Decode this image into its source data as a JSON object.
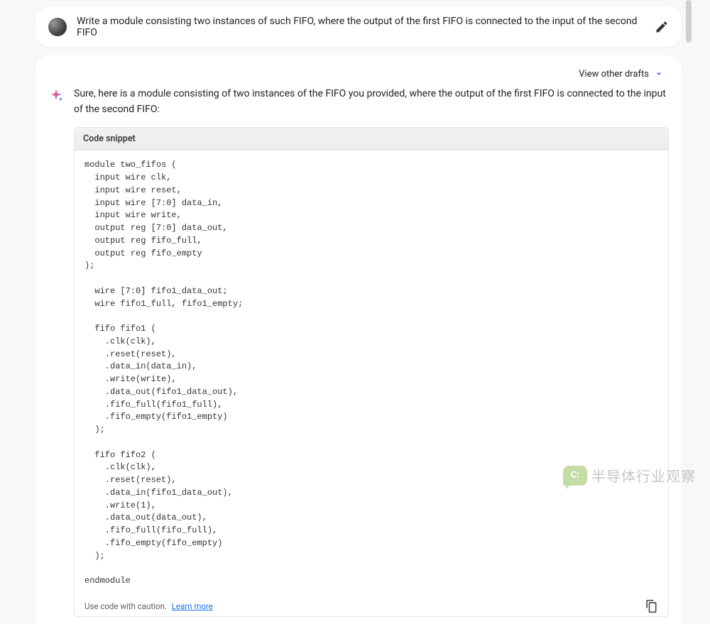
{
  "user": {
    "prompt": "Write a module consisting two instances of such FIFO, where the output of the first FIFO is connected to the input of the second FIFO"
  },
  "response": {
    "view_drafts_label": "View other drafts",
    "intro": "Sure, here is a module consisting of two instances of the FIFO you provided, where the output of the first FIFO is connected to the input of the second FIFO:",
    "code_header": "Code snippet",
    "code": "module two_fifos (\n  input wire clk,\n  input wire reset,\n  input wire [7:0] data_in,\n  input wire write,\n  output reg [7:0] data_out,\n  output reg fifo_full,\n  output reg fifo_empty\n);\n\n  wire [7:0] fifo1_data_out;\n  wire fifo1_full, fifo1_empty;\n\n  fifo fifo1 (\n    .clk(clk),\n    .reset(reset),\n    .data_in(data_in),\n    .write(write),\n    .data_out(fifo1_data_out),\n    .fifo_full(fifo1_full),\n    .fifo_empty(fifo1_empty)\n  );\n\n  fifo fifo2 (\n    .clk(clk),\n    .reset(reset),\n    .data_in(fifo1_data_out),\n    .write(1),\n    .data_out(data_out),\n    .fifo_full(fifo_full),\n    .fifo_empty(fifo_empty)\n  );\n\nendmodule",
    "caution_text": "Use code with caution.",
    "learn_more": "Learn more"
  },
  "watermark": {
    "bubble": "C:",
    "text": "半导体行业观察"
  }
}
